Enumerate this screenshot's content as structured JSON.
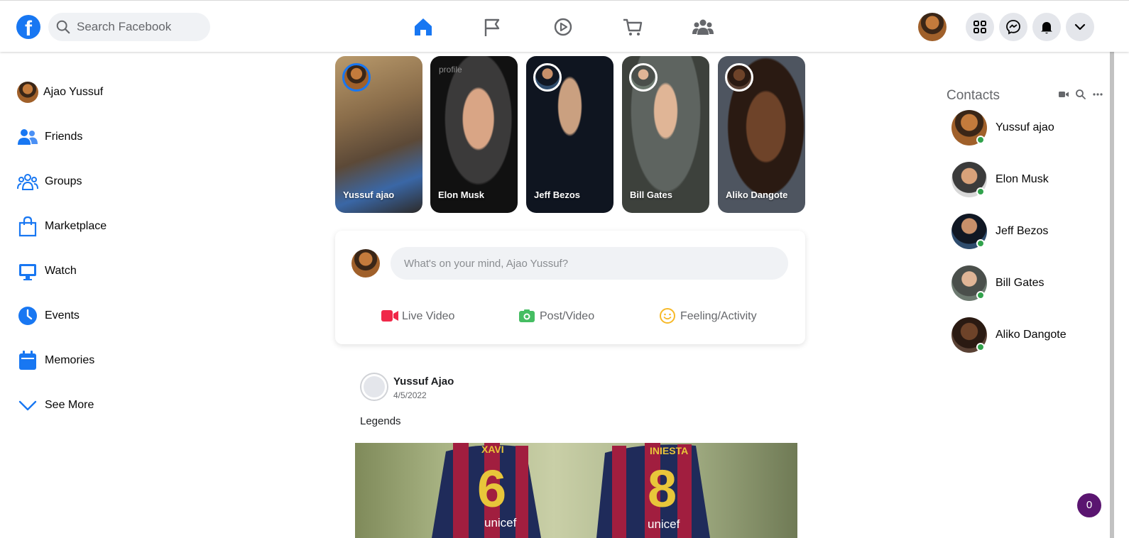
{
  "header": {
    "search_placeholder": "Search Facebook",
    "nav": [
      "home-icon",
      "flag-icon",
      "watch-icon",
      "marketplace-icon",
      "groups-icon"
    ],
    "right_buttons": [
      "menu-grid-icon",
      "messenger-icon",
      "bell-icon",
      "chevron-down-icon"
    ]
  },
  "sidebar": {
    "profile_name": "Ajao Yussuf",
    "items": [
      {
        "label": "Friends",
        "icon": "friends-icon"
      },
      {
        "label": "Groups",
        "icon": "groups-icon"
      },
      {
        "label": "Marketplace",
        "icon": "marketplace-icon"
      },
      {
        "label": "Watch",
        "icon": "watch-icon"
      },
      {
        "label": "Events",
        "icon": "clock-icon"
      },
      {
        "label": "Memories",
        "icon": "calendar-icon"
      },
      {
        "label": "See More",
        "icon": "chevron-down-icon"
      }
    ]
  },
  "stories": [
    {
      "name": "Yussuf ajao"
    },
    {
      "name": "Elon Musk",
      "broken_image_alt": "profile"
    },
    {
      "name": "Jeff Bezos"
    },
    {
      "name": "Bill Gates"
    },
    {
      "name": "Aliko Dangote"
    }
  ],
  "composer": {
    "placeholder": "What's on your mind, Ajao Yussuf?",
    "actions": [
      {
        "label": "Live Video",
        "icon": "video-camera-icon",
        "color": "#f02849"
      },
      {
        "label": "Post/Video",
        "icon": "photo-icon",
        "color": "#45bd62"
      },
      {
        "label": "Feeling/Activity",
        "icon": "smiley-icon",
        "color": "#f7b928"
      }
    ]
  },
  "post": {
    "author": "Yussuf Ajao",
    "date": "4/5/2022",
    "text": "Legends",
    "image_jerseys": [
      {
        "name": "XAVI",
        "number": "6",
        "sponsor": "unicef"
      },
      {
        "name": "INIESTA",
        "number": "8",
        "sponsor": "unicef"
      }
    ]
  },
  "contacts": {
    "title": "Contacts",
    "people": [
      "Yussuf ajao",
      "Elon Musk",
      "Jeff Bezos",
      "Bill Gates",
      "Aliko Dangote"
    ]
  },
  "notification_badge": "0",
  "colors": {
    "brand": "#1877f2",
    "online": "#31a24c",
    "badge": "#5a1570"
  }
}
